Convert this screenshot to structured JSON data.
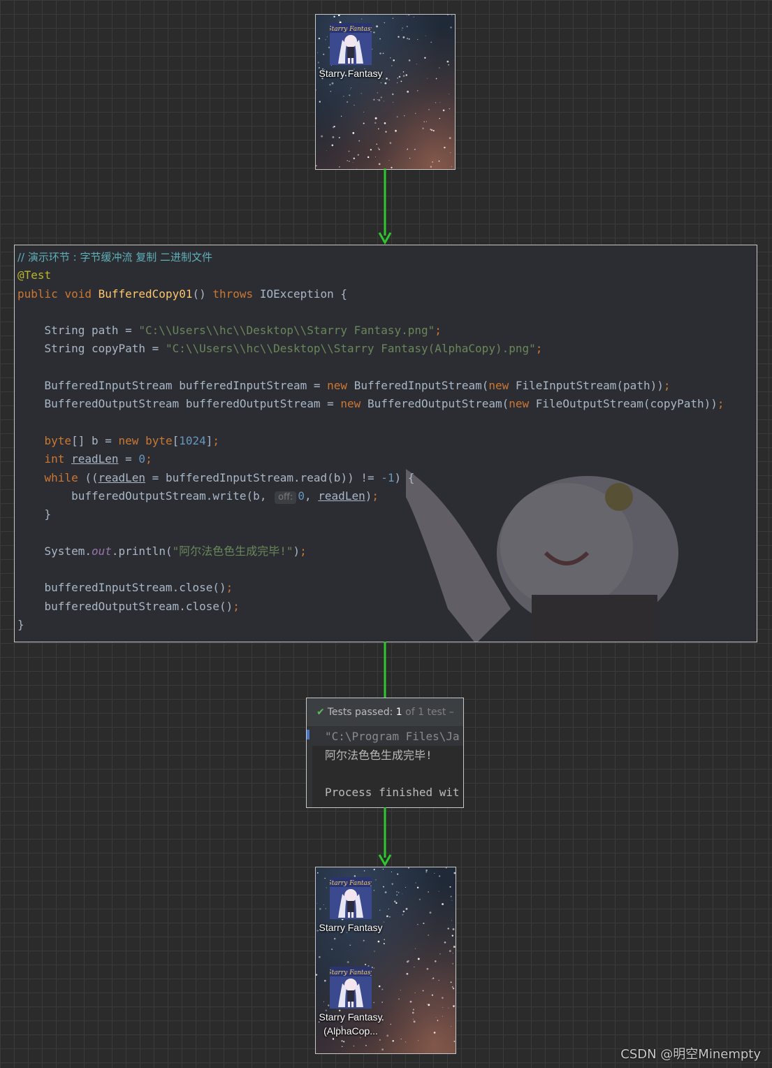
{
  "desktop_top": {
    "files": [
      {
        "name": "Starry Fantasy",
        "icon": "anime-character-thumbnail-icon"
      }
    ]
  },
  "code_editor": {
    "comment": "// 演示环节 : 字节缓冲流 复制 二进制文件",
    "annotation": "@Test",
    "kw_public": "public",
    "kw_void": "void",
    "method_name": "BufferedCopy01",
    "kw_throws": "throws",
    "exception": "IOException",
    "type_string": "String",
    "var_path": "path",
    "path_value": "\"C:\\\\Users\\\\hc\\\\Desktop\\\\Starry Fantasy.png\"",
    "var_copy_path": "copyPath",
    "copy_path_value": "\"C:\\\\Users\\\\hc\\\\Desktop\\\\Starry Fantasy(AlphaCopy).png\"",
    "type_bis": "BufferedInputStream",
    "var_bis": "bufferedInputStream",
    "kw_new": "new",
    "type_fis": "FileInputStream",
    "type_bos": "BufferedOutputStream",
    "var_bos": "bufferedOutputStream",
    "type_fos": "FileOutputStream",
    "type_byte": "byte",
    "var_b": "b",
    "num_1024": "1024",
    "type_int": "int",
    "var_readlen": "readLen",
    "num_0": "0",
    "kw_while": "while",
    "method_read": "read",
    "num_minus1": "-1",
    "method_write": "write",
    "hint_off": "off:",
    "system": "System",
    "field_out": "out",
    "method_println": "println",
    "print_string": "\"阿尔法色色生成完毕!\"",
    "method_close": "close"
  },
  "test_result": {
    "passed_label": "Tests passed:",
    "passed_count": "1",
    "passed_rest": "of 1 test –",
    "console_lines": [
      "\"C:\\Program Files\\Ja",
      "阿尔法色色生成完毕!",
      "",
      "Process finished wit"
    ]
  },
  "desktop_bottom": {
    "files": [
      {
        "name": "Starry Fantasy",
        "icon": "anime-character-thumbnail-icon"
      },
      {
        "name": "Starry Fantasy(AlphaCop...",
        "icon": "anime-character-thumbnail-icon"
      }
    ]
  },
  "watermark": "CSDN @明空Minempty",
  "colors": {
    "arrow": "#2ec82e",
    "background": "#2b2b2b",
    "keyword": "#cc7832",
    "string": "#6a8759",
    "number": "#6897bb",
    "method": "#ffc66d",
    "annotation": "#bbb529",
    "comment": "#5fb0b7"
  }
}
